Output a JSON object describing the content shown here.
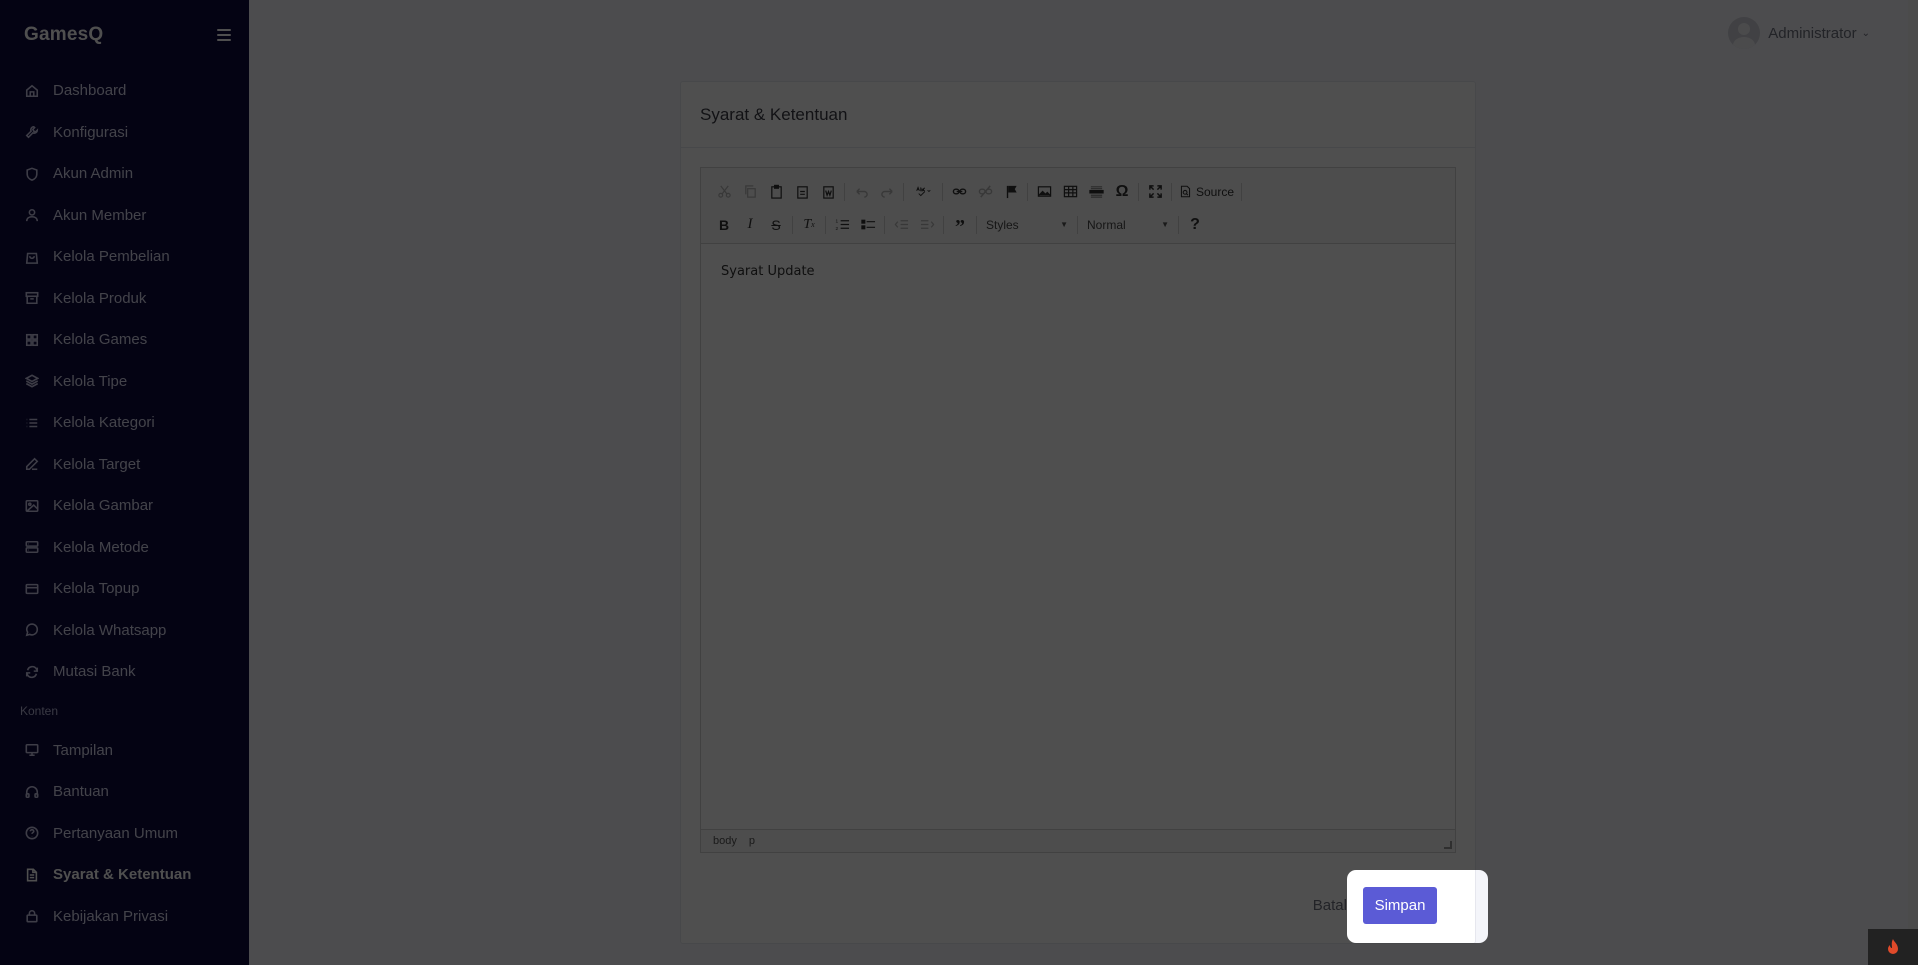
{
  "app": {
    "brand": "GamesQ"
  },
  "sidebar": {
    "items": [
      {
        "label": "Dashboard",
        "icon": "home-icon"
      },
      {
        "label": "Konfigurasi",
        "icon": "wrench-icon"
      },
      {
        "label": "Akun Admin",
        "icon": "shield-icon"
      },
      {
        "label": "Akun Member",
        "icon": "user-icon"
      },
      {
        "label": "Kelola Pembelian",
        "icon": "shopping-bag-icon"
      },
      {
        "label": "Kelola Produk",
        "icon": "archive-icon"
      },
      {
        "label": "Kelola Games",
        "icon": "grid-icon"
      },
      {
        "label": "Kelola Tipe",
        "icon": "layers-icon"
      },
      {
        "label": "Kelola Kategori",
        "icon": "list-icon"
      },
      {
        "label": "Kelola Target",
        "icon": "edit-icon"
      },
      {
        "label": "Kelola Gambar",
        "icon": "image-icon"
      },
      {
        "label": "Kelola Metode",
        "icon": "server-icon"
      },
      {
        "label": "Kelola Topup",
        "icon": "credit-card-icon"
      },
      {
        "label": "Kelola Whatsapp",
        "icon": "message-circle-icon"
      },
      {
        "label": "Mutasi Bank",
        "icon": "refresh-icon"
      }
    ],
    "section_header": "Konten",
    "content_items": [
      {
        "label": "Tampilan",
        "icon": "monitor-icon"
      },
      {
        "label": "Bantuan",
        "icon": "headphones-icon"
      },
      {
        "label": "Pertanyaan Umum",
        "icon": "help-circle-icon"
      },
      {
        "label": "Syarat & Ketentuan",
        "icon": "file-text-icon",
        "active": true
      },
      {
        "label": "Kebijakan Privasi",
        "icon": "lock-icon"
      }
    ]
  },
  "topbar": {
    "user_name": "Administrator"
  },
  "card": {
    "title": "Syarat & Ketentuan",
    "editor": {
      "content": "Syarat Update",
      "styles_combo": "Styles",
      "format_combo": "Normal",
      "source_label": "Source",
      "path": [
        "body",
        "p"
      ]
    },
    "actions": {
      "cancel_label": "Batal",
      "save_label": "Simpan"
    }
  },
  "colors": {
    "sidebar_bg": "#0e0b3d",
    "accent": "#5b5bd6"
  }
}
